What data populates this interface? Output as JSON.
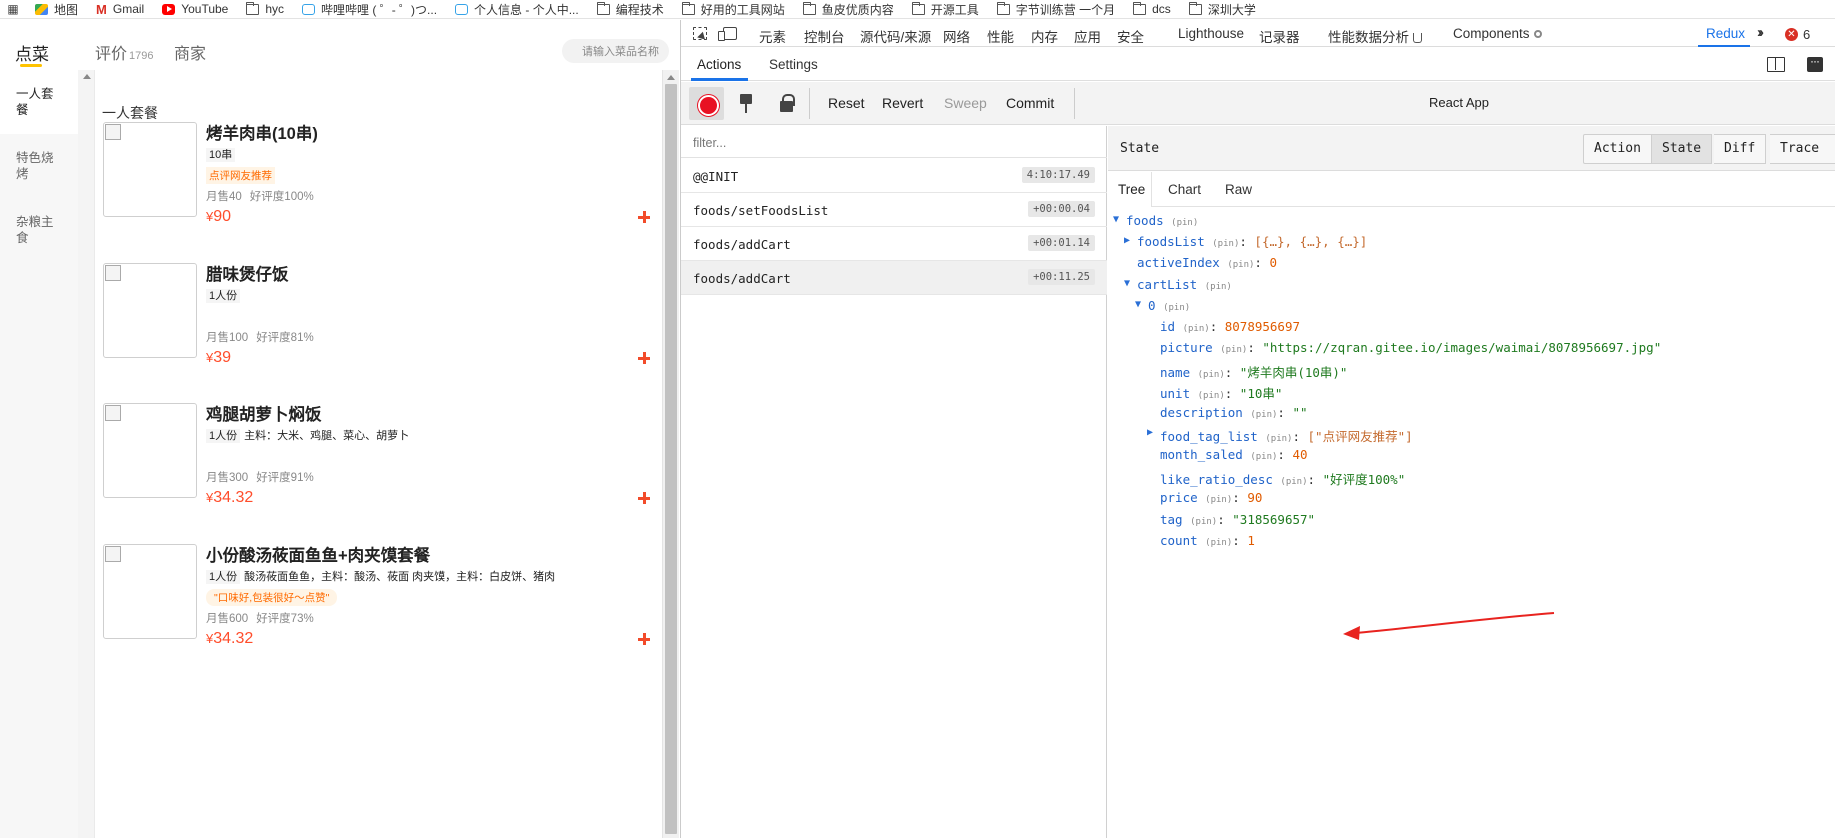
{
  "bookmarks": [
    {
      "label": "地图",
      "icon": "maps-icon"
    },
    {
      "label": "Gmail",
      "icon": "gmail-icon"
    },
    {
      "label": "YouTube",
      "icon": "youtube-icon"
    },
    {
      "label": "hyc",
      "icon": "folder-icon"
    },
    {
      "label": "哔哩哔哩 ( ゜- ゜)つ...",
      "icon": "bilibili-icon"
    },
    {
      "label": "个人信息 - 个人中...",
      "icon": "bilibili-icon"
    },
    {
      "label": "编程技术",
      "icon": "folder-icon"
    },
    {
      "label": "好用的工具网站",
      "icon": "folder-icon"
    },
    {
      "label": "鱼皮优质内容",
      "icon": "folder-icon"
    },
    {
      "label": "开源工具",
      "icon": "folder-icon"
    },
    {
      "label": "字节训练营 一个月",
      "icon": "folder-icon"
    },
    {
      "label": "dcs",
      "icon": "folder-icon"
    },
    {
      "label": "深圳大学",
      "icon": "folder-icon"
    }
  ],
  "app": {
    "tabs": {
      "order": "点菜",
      "reviews": "评价",
      "reviews_count": "1796",
      "merchant": "商家"
    },
    "search_placeholder": "请输入菜品名称",
    "categories": [
      "一人套餐",
      "特色烧烤",
      "杂粮主食"
    ],
    "group_title": "一人套餐",
    "foods": [
      {
        "name": "烤羊肉串(10串)",
        "unit": "10串",
        "desc": "",
        "tag": "点评网友推荐",
        "tag_style": "box",
        "sales": "月售40",
        "rating": "好评度100%",
        "currency": "¥",
        "price": "90"
      },
      {
        "name": "腊味煲仔饭",
        "unit": "1人份",
        "desc": "",
        "tag": "",
        "tag_style": "",
        "sales": "月售100",
        "rating": "好评度81%",
        "currency": "¥",
        "price": "39"
      },
      {
        "name": "鸡腿胡萝卜焖饭",
        "unit": "1人份",
        "desc": "主料：大米、鸡腿、菜心、胡萝卜",
        "tag": "",
        "tag_style": "",
        "sales": "月售300",
        "rating": "好评度91%",
        "currency": "¥",
        "price": "34.32"
      },
      {
        "name": "小份酸汤莜面鱼鱼+肉夹馍套餐",
        "unit": "1人份",
        "desc": "酸汤莜面鱼鱼，主料：酸汤、莜面 肉夹馍，主料：白皮饼、猪肉",
        "tag": "\"口味好,包装很好～点赞\"",
        "tag_style": "pill",
        "sales": "月售600",
        "rating": "好评度73%",
        "currency": "¥",
        "price": "34.32"
      }
    ]
  },
  "devtools": {
    "tabs": [
      "元素",
      "控制台",
      "源代码/来源",
      "网络",
      "性能",
      "内存",
      "应用",
      "安全",
      "Lighthouse",
      "记录器",
      "性能数据分析",
      "Components",
      "Redux"
    ],
    "active_tab": "Redux",
    "error_count": "6",
    "redux": {
      "subtabs": [
        "Actions",
        "Settings"
      ],
      "toolbar": {
        "reset": "Reset",
        "revert": "Revert",
        "sweep": "Sweep",
        "commit": "Commit",
        "instance": "React App"
      },
      "filter_placeholder": "filter...",
      "actions": [
        {
          "name": "@@INIT",
          "time": "4:10:17.49"
        },
        {
          "name": "foods/setFoodsList",
          "time": "+00:00.04"
        },
        {
          "name": "foods/addCart",
          "time": "+00:01.14"
        },
        {
          "name": "foods/addCart",
          "time": "+00:11.25"
        }
      ],
      "state_title": "State",
      "monitor_tabs": [
        "Action",
        "State",
        "Diff",
        "Trace"
      ],
      "view_tabs": [
        "Tree",
        "Chart",
        "Raw"
      ],
      "pin_label": "(pin)",
      "tree": {
        "root": "foods",
        "foodsList_key": "foodsList",
        "foodsList_preview": "[{…}, {…}, {…}]",
        "activeIndex_key": "activeIndex",
        "activeIndex": "0",
        "cartList_key": "cartList",
        "item_index": "0",
        "fields": [
          {
            "key": "id",
            "value": "8078956697",
            "type": "n"
          },
          {
            "key": "picture",
            "value": "\"https://zqran.gitee.io/images/waimai/8078956697.jpg\"",
            "type": "s"
          },
          {
            "key": "name",
            "value": "\"烤羊肉串(10串)\"",
            "type": "s"
          },
          {
            "key": "unit",
            "value": "\"10串\"",
            "type": "s"
          },
          {
            "key": "description",
            "value": "\"\"",
            "type": "s"
          },
          {
            "key": "food_tag_list",
            "value": "[\"点评网友推荐\"]",
            "type": "a"
          },
          {
            "key": "month_saled",
            "value": "40",
            "type": "n"
          },
          {
            "key": "like_ratio_desc",
            "value": "\"好评度100%\"",
            "type": "s"
          },
          {
            "key": "price",
            "value": "90",
            "type": "n"
          },
          {
            "key": "tag",
            "value": "\"318569657\"",
            "type": "s"
          },
          {
            "key": "count",
            "value": "1",
            "type": "n"
          }
        ]
      }
    }
  },
  "annotation": {
    "color": "#e8231f"
  }
}
